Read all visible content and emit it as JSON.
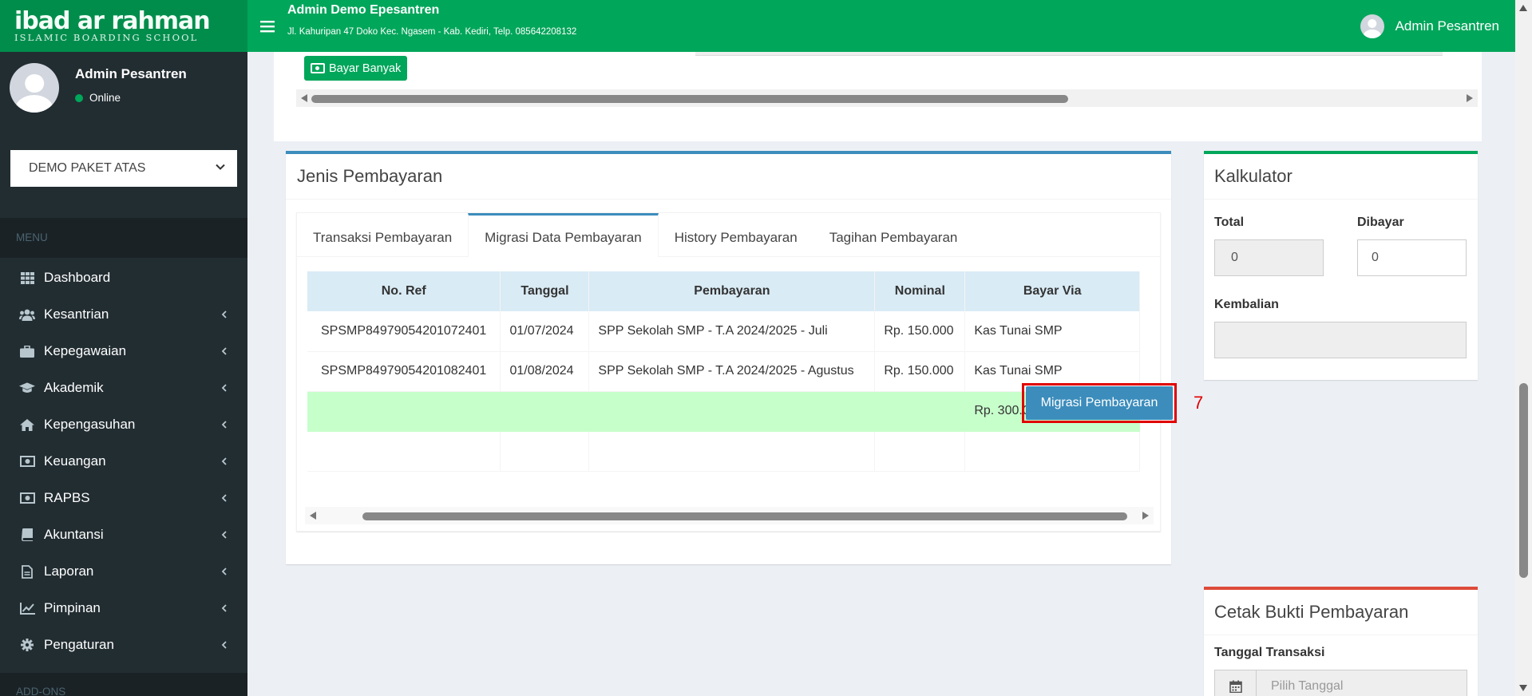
{
  "header": {
    "logo_main": "ibad ar rahman",
    "logo_sub": "ISLAMIC BOARDING SCHOOL",
    "title": "Admin Demo Epesantren",
    "address": "Jl. Kahuripan 47 Doko Kec. Ngasem - Kab. Kediri, Telp. 085642208132",
    "user_name": "Admin Pesantren"
  },
  "sidebar": {
    "user_name": "Admin Pesantren",
    "status": "Online",
    "package_select": "DEMO PAKET ATAS",
    "menu_header": "MENU",
    "addons_header": "ADD-ONS",
    "items": [
      {
        "label": "Dashboard",
        "icon": "grid-icon",
        "has_children": false
      },
      {
        "label": "Kesantrian",
        "icon": "users-icon",
        "has_children": true
      },
      {
        "label": "Kepegawaian",
        "icon": "briefcase-icon",
        "has_children": true
      },
      {
        "label": "Akademik",
        "icon": "graduation-cap-icon",
        "has_children": true
      },
      {
        "label": "Kepengasuhan",
        "icon": "home-icon",
        "has_children": true
      },
      {
        "label": "Keuangan",
        "icon": "money-icon",
        "has_children": true
      },
      {
        "label": "RAPBS",
        "icon": "money-icon",
        "has_children": true
      },
      {
        "label": "Akuntansi",
        "icon": "book-icon",
        "has_children": true
      },
      {
        "label": "Laporan",
        "icon": "file-icon",
        "has_children": true
      },
      {
        "label": "Pimpinan",
        "icon": "line-chart-icon",
        "has_children": true
      },
      {
        "label": "Pengaturan",
        "icon": "gear-icon",
        "has_children": true
      }
    ]
  },
  "top_panel": {
    "bayar_banyak_label": "Bayar Banyak"
  },
  "jenis_pembayaran": {
    "title": "Jenis Pembayaran",
    "tabs": [
      {
        "label": "Transaksi Pembayaran",
        "active": false
      },
      {
        "label": "Migrasi Data Pembayaran",
        "active": true
      },
      {
        "label": "History Pembayaran",
        "active": false
      },
      {
        "label": "Tagihan Pembayaran",
        "active": false
      }
    ],
    "table": {
      "columns": [
        "No. Ref",
        "Tanggal",
        "Pembayaran",
        "Nominal",
        "Bayar Via"
      ],
      "rows": [
        [
          "SPSMP84979054201072401",
          "01/07/2024",
          "SPP Sekolah SMP - T.A 2024/2025 - Juli",
          "Rp. 150.000",
          "Kas Tunai SMP"
        ],
        [
          "SPSMP84979054201082401",
          "01/08/2024",
          "SPP Sekolah SMP - T.A 2024/2025 - Agustus",
          "Rp. 150.000",
          "Kas Tunai SMP"
        ]
      ],
      "total": "Rp. 300.000"
    },
    "migrasi_button_label": "Migrasi Pembayaran",
    "annotation_marker": "7"
  },
  "kalkulator": {
    "title": "Kalkulator",
    "total_label": "Total",
    "total_value": "0",
    "dibayar_label": "Dibayar",
    "dibayar_value": "0",
    "kembalian_label": "Kembalian",
    "kembalian_value": ""
  },
  "cetak_bukti": {
    "title": "Cetak Bukti Pembayaran",
    "tanggal_label": "Tanggal Transaksi",
    "tanggal_placeholder": "Pilih Tanggal"
  },
  "colors": {
    "header_green": "#00a65a",
    "sidebar_dark": "#222d32",
    "primary_blue": "#3c8dbc",
    "annotation_red": "#e00000",
    "total_row_green": "#c7ffcb"
  }
}
